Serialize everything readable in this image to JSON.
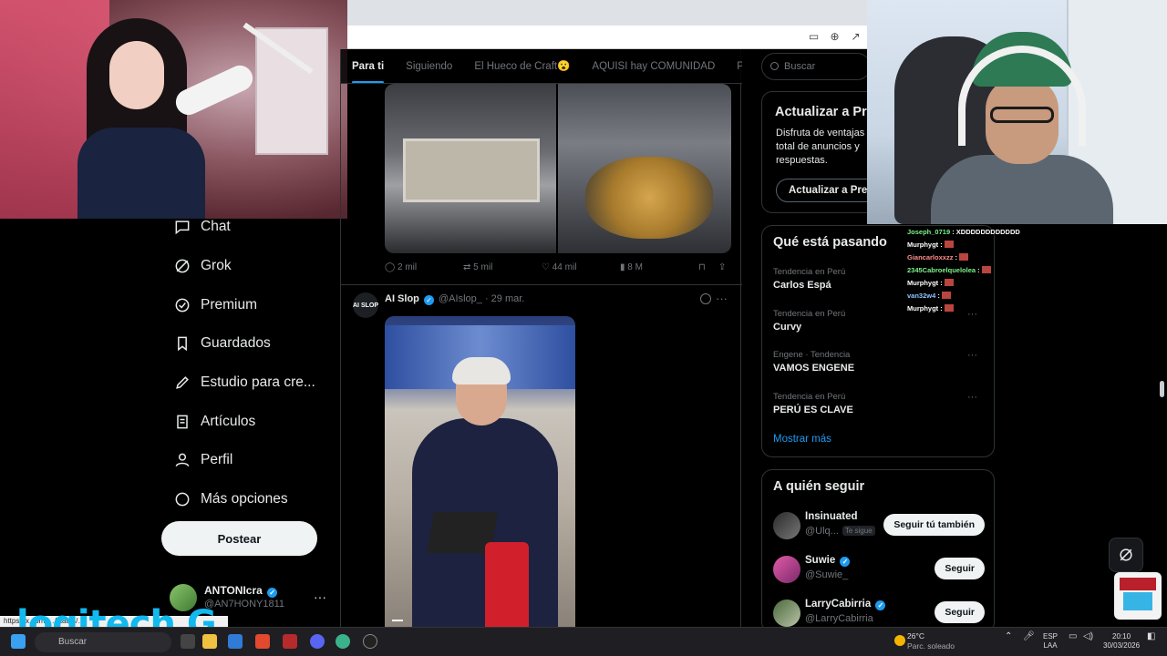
{
  "browser": {
    "icons": [
      "screenshot-icon",
      "zoom-icon",
      "share-icon"
    ]
  },
  "nav": {
    "items": [
      {
        "label": "Chat",
        "icon": "chat-icon"
      },
      {
        "label": "Grok",
        "icon": "grok-icon"
      },
      {
        "label": "Premium",
        "icon": "premium-icon"
      },
      {
        "label": "Guardados",
        "icon": "bookmark-icon"
      },
      {
        "label": "Estudio para cre...",
        "icon": "studio-icon"
      },
      {
        "label": "Artículos",
        "icon": "articles-icon"
      },
      {
        "label": "Perfil",
        "icon": "profile-icon"
      },
      {
        "label": "Más opciones",
        "icon": "more-options-icon"
      }
    ],
    "post_label": "Postear",
    "account": {
      "name": "ANTONIcra",
      "handle": "@AN7HONY1811",
      "more": "···"
    }
  },
  "overlay": {
    "logo_text": "logitech G",
    "status_url": "https://x.com/…/status/…"
  },
  "tabs": [
    {
      "label": "Para ti",
      "active": true
    },
    {
      "label": "Siguiendo",
      "active": false
    },
    {
      "label": "El Hueco de Craft😮",
      "active": false
    },
    {
      "label": "AQUISI hay COMUNIDAD",
      "active": false
    },
    {
      "label": "Pa",
      "active": false
    }
  ],
  "tweet1": {
    "replies": "2 mil",
    "retweets": "5 mil",
    "likes": "44 mil",
    "views": "8 M"
  },
  "tweet2": {
    "avatar_text": "AI SLOP",
    "name": "AI Slop",
    "handle": "@AIslop_",
    "date": "· 29 mar.",
    "more": "···"
  },
  "search": {
    "placeholder": "Buscar"
  },
  "premium_card": {
    "title": "Actualizar a Pr",
    "description": "Disfruta de ventajas total de anuncios y respuestas.",
    "button": "Actualizar a Pren"
  },
  "trends": {
    "title": "Qué está pasando",
    "items": [
      {
        "context": "Tendencia en Perú",
        "name": "Carlos Espá"
      },
      {
        "context": "Tendencia en Perú",
        "name": "Curvy"
      },
      {
        "context": "Engene · Tendencia",
        "name": "VAMOS ENGENE"
      },
      {
        "context": "Tendencia en Perú",
        "name": "PERÚ ES CLAVE"
      }
    ],
    "more": "Mostrar más"
  },
  "who_to_follow": {
    "title": "A quién seguir",
    "users": [
      {
        "name": "Insinuated",
        "handle": "@Ulq...",
        "tag": "Te sigue",
        "button": "Seguir tú también",
        "verified": false
      },
      {
        "name": "Suwie",
        "handle": "@Suwie_",
        "tag": "",
        "button": "Seguir",
        "verified": true
      },
      {
        "name": "LarryCabirria",
        "handle": "@LarryCabirria",
        "tag": "",
        "button": "Seguir",
        "verified": true
      }
    ]
  },
  "chat_overlay": [
    {
      "user": "Joseph_0719",
      "msg": ": XDDDDDDDDDDDD",
      "color": "#7df08a"
    },
    {
      "user": "Murphygt",
      "msg": ":",
      "color": "#ffffff"
    },
    {
      "user": "Giancarloxxzz",
      "msg": ":",
      "color": "#ff8c8c"
    },
    {
      "user": "2345Cabroelquelolea",
      "msg": ":",
      "color": "#7df08a"
    },
    {
      "user": "Murphygt",
      "msg": ":",
      "color": "#ffffff"
    },
    {
      "user": "van32w4",
      "msg": ":",
      "color": "#8cc8ff"
    },
    {
      "user": "Murphygt",
      "msg": ":",
      "color": "#ffffff"
    }
  ],
  "taskbar": {
    "search": "Buscar",
    "weather_temp": "26°C",
    "weather_desc": "Parc. soleado",
    "lang1": "ESP",
    "lang2": "LAA",
    "time": "20:10",
    "date": "30/03/2026"
  }
}
